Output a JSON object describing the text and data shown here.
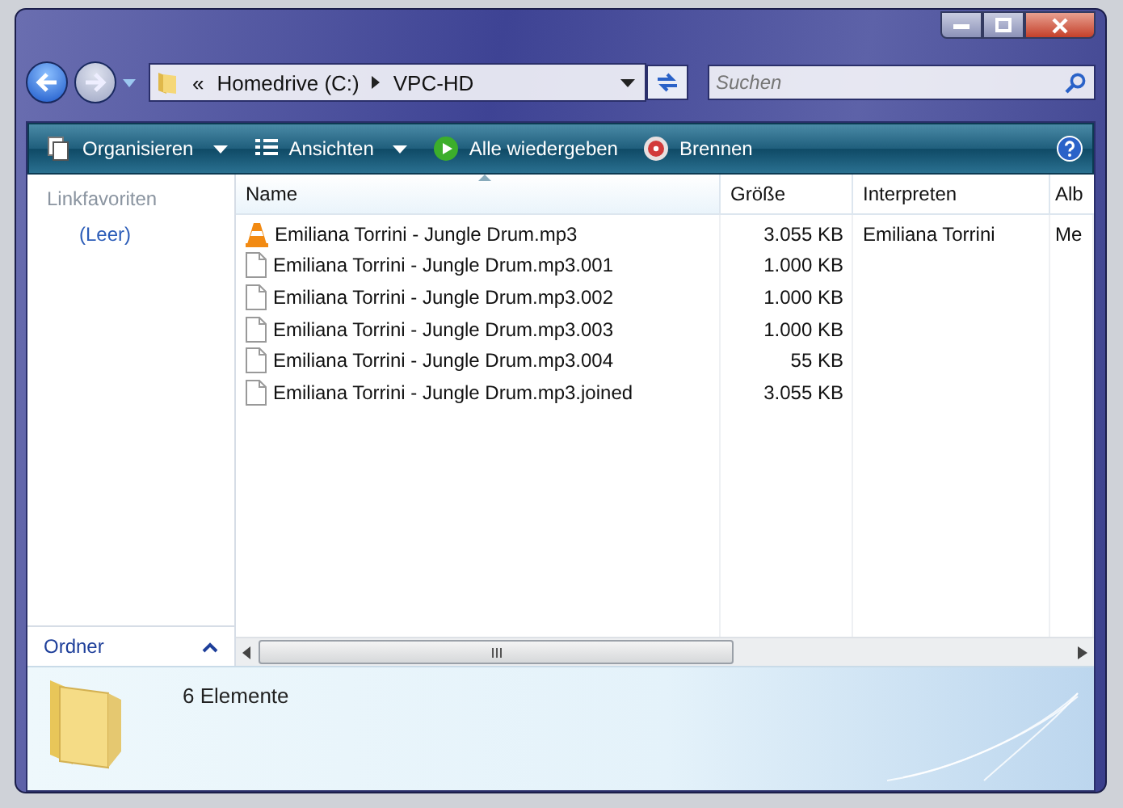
{
  "address": {
    "overflow": "«",
    "path": [
      "Homedrive (C:)",
      "VPC-HD"
    ]
  },
  "search": {
    "placeholder": "Suchen"
  },
  "toolbar": [
    {
      "label": "Organisieren",
      "kind": "stack",
      "dropdown": true
    },
    {
      "label": "Ansichten",
      "kind": "views",
      "dropdown": true
    },
    {
      "label": "Alle wiedergeben",
      "kind": "play",
      "dropdown": false
    },
    {
      "label": "Brennen",
      "kind": "burn",
      "dropdown": false
    }
  ],
  "sidebar": {
    "title": "Linkfavoriten",
    "items": [
      "(Leer)"
    ],
    "folders": "Ordner"
  },
  "table": {
    "columns": [
      {
        "label": "Name",
        "sorted": true
      },
      {
        "label": "Größe",
        "sorted": false
      },
      {
        "label": "Interpreten",
        "sorted": false
      },
      {
        "label": "Alb",
        "sorted": false
      }
    ],
    "rows": [
      {
        "kind": "vlc",
        "cells": [
          "Emiliana Torrini - Jungle Drum.mp3",
          "3.055 KB",
          "Emiliana Torrini",
          "Me"
        ]
      },
      {
        "kind": "file",
        "cells": [
          "Emiliana Torrini - Jungle Drum.mp3.001",
          "1.000 KB",
          "",
          ""
        ]
      },
      {
        "kind": "file",
        "cells": [
          "Emiliana Torrini - Jungle Drum.mp3.002",
          "1.000 KB",
          "",
          ""
        ]
      },
      {
        "kind": "file",
        "cells": [
          "Emiliana Torrini - Jungle Drum.mp3.003",
          "1.000 KB",
          "",
          ""
        ]
      },
      {
        "kind": "file",
        "cells": [
          "Emiliana Torrini - Jungle Drum.mp3.004",
          "55 KB",
          "",
          ""
        ]
      },
      {
        "kind": "file",
        "cells": [
          "Emiliana Torrini - Jungle Drum.mp3.joined",
          "3.055 KB",
          "",
          ""
        ]
      }
    ]
  },
  "status_bar": {
    "text": "6 Elemente"
  }
}
